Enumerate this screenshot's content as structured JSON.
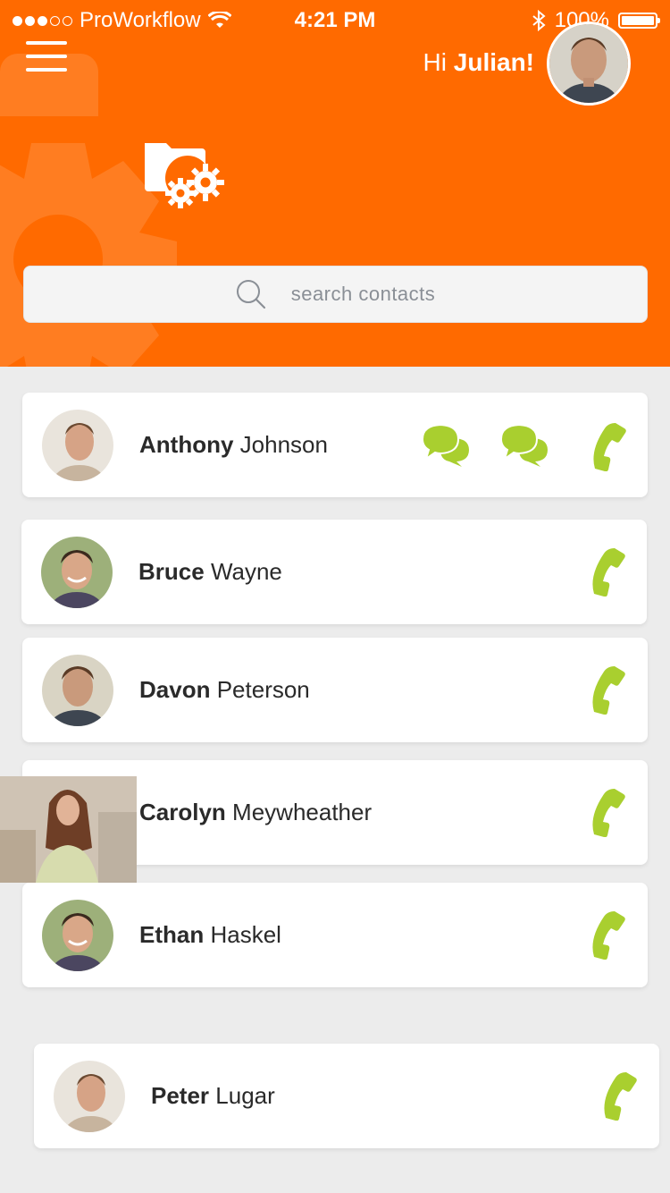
{
  "status_bar": {
    "carrier": "ProWorkflow",
    "time": "4:21 PM",
    "battery": "100%",
    "signal_bars": 3
  },
  "header": {
    "greeting_prefix": "Hi",
    "user_name": "Julian!",
    "menu_icon": "hamburger-menu-icon",
    "logo_icon": "folder-gears-icon"
  },
  "search": {
    "placeholder": "search contacts"
  },
  "contacts": [
    {
      "first": "Anthony",
      "last": "Johnson",
      "actions": [
        "chat-icon",
        "chat-icon",
        "phone-icon"
      ]
    },
    {
      "first": "Bruce",
      "last": "Wayne",
      "actions": [
        "phone-icon"
      ]
    },
    {
      "first": "Davon",
      "last": "Peterson",
      "actions": [
        "phone-icon"
      ]
    },
    {
      "first": "Carolyn",
      "last": "Meywheather",
      "actions": [
        "phone-icon"
      ]
    },
    {
      "first": "Ethan",
      "last": "Haskel",
      "actions": [
        "phone-icon"
      ]
    },
    {
      "first": "Peter",
      "last": "Lugar",
      "actions": [
        "phone-icon"
      ]
    }
  ],
  "colors": {
    "accent": "#ff6a00",
    "action_green": "#a9cf2f",
    "background": "#ececec"
  }
}
